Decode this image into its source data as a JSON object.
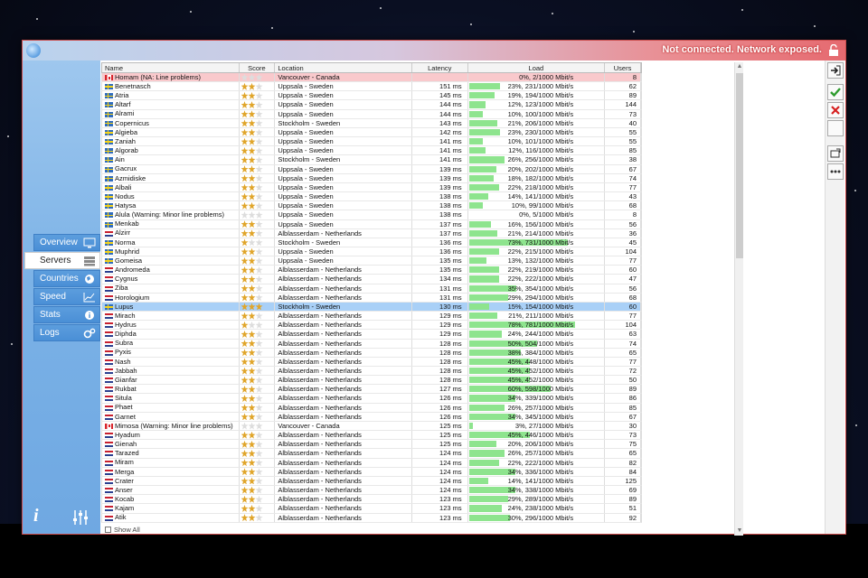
{
  "titlebar": {
    "status": "Not connected. Network exposed."
  },
  "nav": [
    {
      "label": "Overview",
      "icon": "monitor-icon"
    },
    {
      "label": "Servers",
      "icon": "server-icon"
    },
    {
      "label": "Countries",
      "icon": "globe-icon"
    },
    {
      "label": "Speed",
      "icon": "chart-icon"
    },
    {
      "label": "Stats",
      "icon": "info-circle-icon"
    },
    {
      "label": "Logs",
      "icon": "gears-icon"
    }
  ],
  "table": {
    "columns": [
      "Name",
      "Score",
      "Location",
      "Latency",
      "Load",
      "Users"
    ],
    "rows": [
      {
        "name": "Homam (NA: Line problems)",
        "flag": "ca",
        "score": 0,
        "location": "Vancouver - Canada",
        "latency": "",
        "load": "0%, 2/1000 Mbit/s",
        "pct": 0,
        "users": "8",
        "state": "warn"
      },
      {
        "name": "Benetnasch",
        "flag": "se",
        "score": 2,
        "location": "Uppsala - Sweden",
        "latency": "151 ms",
        "load": "23%, 231/1000 Mbit/s",
        "pct": 23,
        "users": "62"
      },
      {
        "name": "Atria",
        "flag": "se",
        "score": 2,
        "location": "Uppsala - Sweden",
        "latency": "145 ms",
        "load": "19%, 194/1000 Mbit/s",
        "pct": 19,
        "users": "89"
      },
      {
        "name": "Altarf",
        "flag": "se",
        "score": 2,
        "location": "Uppsala - Sweden",
        "latency": "144 ms",
        "load": "12%, 123/1000 Mbit/s",
        "pct": 12,
        "users": "144"
      },
      {
        "name": "Alrami",
        "flag": "se",
        "score": 2,
        "location": "Uppsala - Sweden",
        "latency": "144 ms",
        "load": "10%, 100/1000 Mbit/s",
        "pct": 10,
        "users": "73"
      },
      {
        "name": "Copernicus",
        "flag": "se",
        "score": 2,
        "location": "Stockholm - Sweden",
        "latency": "143 ms",
        "load": "21%, 206/1000 Mbit/s",
        "pct": 21,
        "users": "40"
      },
      {
        "name": "Algieba",
        "flag": "se",
        "score": 2,
        "location": "Uppsala - Sweden",
        "latency": "142 ms",
        "load": "23%, 230/1000 Mbit/s",
        "pct": 23,
        "users": "55"
      },
      {
        "name": "Zaniah",
        "flag": "se",
        "score": 2,
        "location": "Uppsala - Sweden",
        "latency": "141 ms",
        "load": "10%, 101/1000 Mbit/s",
        "pct": 10,
        "users": "55"
      },
      {
        "name": "Algorab",
        "flag": "se",
        "score": 2,
        "location": "Uppsala - Sweden",
        "latency": "141 ms",
        "load": "12%, 116/1000 Mbit/s",
        "pct": 12,
        "users": "85"
      },
      {
        "name": "Ain",
        "flag": "se",
        "score": 2,
        "location": "Stockholm - Sweden",
        "latency": "141 ms",
        "load": "26%, 256/1000 Mbit/s",
        "pct": 26,
        "users": "38"
      },
      {
        "name": "Gacrux",
        "flag": "se",
        "score": 2,
        "location": "Uppsala - Sweden",
        "latency": "139 ms",
        "load": "20%, 202/1000 Mbit/s",
        "pct": 20,
        "users": "67"
      },
      {
        "name": "Azmidiske",
        "flag": "se",
        "score": 2,
        "location": "Uppsala - Sweden",
        "latency": "139 ms",
        "load": "18%, 182/1000 Mbit/s",
        "pct": 18,
        "users": "74"
      },
      {
        "name": "Albali",
        "flag": "se",
        "score": 2,
        "location": "Uppsala - Sweden",
        "latency": "139 ms",
        "load": "22%, 218/1000 Mbit/s",
        "pct": 22,
        "users": "77"
      },
      {
        "name": "Nodus",
        "flag": "se",
        "score": 2,
        "location": "Uppsala - Sweden",
        "latency": "138 ms",
        "load": "14%, 141/1000 Mbit/s",
        "pct": 14,
        "users": "43"
      },
      {
        "name": "Hatysa",
        "flag": "se",
        "score": 2,
        "location": "Uppsala - Sweden",
        "latency": "138 ms",
        "load": "10%, 99/1000 Mbit/s",
        "pct": 10,
        "users": "68"
      },
      {
        "name": "Alula (Warning: Minor line problems)",
        "flag": "se",
        "score": 0,
        "location": "Uppsala - Sweden",
        "latency": "138 ms",
        "load": "0%, 5/1000 Mbit/s",
        "pct": 0,
        "users": "8"
      },
      {
        "name": "Menkab",
        "flag": "se",
        "score": 2,
        "location": "Uppsala - Sweden",
        "latency": "137 ms",
        "load": "16%, 156/1000 Mbit/s",
        "pct": 16,
        "users": "56"
      },
      {
        "name": "Alzirr",
        "flag": "nl",
        "score": 2,
        "location": "Alblasserdam - Netherlands",
        "latency": "137 ms",
        "load": "21%, 214/1000 Mbit/s",
        "pct": 21,
        "users": "36"
      },
      {
        "name": "Norma",
        "flag": "se",
        "score": 1,
        "location": "Stockholm - Sweden",
        "latency": "136 ms",
        "load": "73%, 731/1000 Mbit/s",
        "pct": 73,
        "users": "45"
      },
      {
        "name": "Muphrid",
        "flag": "se",
        "score": 2,
        "location": "Uppsala - Sweden",
        "latency": "136 ms",
        "load": "22%, 215/1000 Mbit/s",
        "pct": 22,
        "users": "104"
      },
      {
        "name": "Gomeisa",
        "flag": "se",
        "score": 2,
        "location": "Uppsala - Sweden",
        "latency": "135 ms",
        "load": "13%, 132/1000 Mbit/s",
        "pct": 13,
        "users": "77"
      },
      {
        "name": "Andromeda",
        "flag": "nl",
        "score": 2,
        "location": "Alblasserdam - Netherlands",
        "latency": "135 ms",
        "load": "22%, 219/1000 Mbit/s",
        "pct": 22,
        "users": "60"
      },
      {
        "name": "Cygnus",
        "flag": "nl",
        "score": 2,
        "location": "Alblasserdam - Netherlands",
        "latency": "134 ms",
        "load": "22%, 222/1000 Mbit/s",
        "pct": 22,
        "users": "47"
      },
      {
        "name": "Ziba",
        "flag": "nl",
        "score": 2,
        "location": "Alblasserdam - Netherlands",
        "latency": "131 ms",
        "load": "35%, 354/1000 Mbit/s",
        "pct": 35,
        "users": "56"
      },
      {
        "name": "Horologium",
        "flag": "nl",
        "score": 2,
        "location": "Alblasserdam - Netherlands",
        "latency": "131 ms",
        "load": "29%, 294/1000 Mbit/s",
        "pct": 29,
        "users": "68"
      },
      {
        "name": "Lupus",
        "flag": "se",
        "score": 3,
        "location": "Stockholm - Sweden",
        "latency": "130 ms",
        "load": "15%, 154/1000 Mbit/s",
        "pct": 15,
        "users": "60",
        "state": "selected"
      },
      {
        "name": "Mirach",
        "flag": "nl",
        "score": 2,
        "location": "Alblasserdam - Netherlands",
        "latency": "129 ms",
        "load": "21%, 211/1000 Mbit/s",
        "pct": 21,
        "users": "77"
      },
      {
        "name": "Hydrus",
        "flag": "nl",
        "score": 1,
        "location": "Alblasserdam - Netherlands",
        "latency": "129 ms",
        "load": "78%, 781/1000 Mbit/s",
        "pct": 78,
        "users": "104"
      },
      {
        "name": "Diphda",
        "flag": "nl",
        "score": 2,
        "location": "Alblasserdam - Netherlands",
        "latency": "129 ms",
        "load": "24%, 244/1000 Mbit/s",
        "pct": 24,
        "users": "63"
      },
      {
        "name": "Subra",
        "flag": "nl",
        "score": 2,
        "location": "Alblasserdam - Netherlands",
        "latency": "128 ms",
        "load": "50%, 504/1000 Mbit/s",
        "pct": 50,
        "users": "74"
      },
      {
        "name": "Pyxis",
        "flag": "nl",
        "score": 2,
        "location": "Alblasserdam - Netherlands",
        "latency": "128 ms",
        "load": "38%, 384/1000 Mbit/s",
        "pct": 38,
        "users": "65"
      },
      {
        "name": "Nash",
        "flag": "nl",
        "score": 2,
        "location": "Alblasserdam - Netherlands",
        "latency": "128 ms",
        "load": "45%, 448/1000 Mbit/s",
        "pct": 45,
        "users": "77"
      },
      {
        "name": "Jabbah",
        "flag": "nl",
        "score": 2,
        "location": "Alblasserdam - Netherlands",
        "latency": "128 ms",
        "load": "45%, 452/1000 Mbit/s",
        "pct": 45,
        "users": "72"
      },
      {
        "name": "Gianfar",
        "flag": "nl",
        "score": 2,
        "location": "Alblasserdam - Netherlands",
        "latency": "128 ms",
        "load": "45%, 452/1000 Mbit/s",
        "pct": 45,
        "users": "50"
      },
      {
        "name": "Rukbat",
        "flag": "nl",
        "score": 2,
        "location": "Alblasserdam - Netherlands",
        "latency": "127 ms",
        "load": "60%, 598/1000 Mbit/s",
        "pct": 60,
        "users": "89"
      },
      {
        "name": "Situla",
        "flag": "nl",
        "score": 2,
        "location": "Alblasserdam - Netherlands",
        "latency": "126 ms",
        "load": "34%, 339/1000 Mbit/s",
        "pct": 34,
        "users": "86"
      },
      {
        "name": "Phaet",
        "flag": "nl",
        "score": 2,
        "location": "Alblasserdam - Netherlands",
        "latency": "126 ms",
        "load": "26%, 257/1000 Mbit/s",
        "pct": 26,
        "users": "85"
      },
      {
        "name": "Garnet",
        "flag": "nl",
        "score": 2,
        "location": "Alblasserdam - Netherlands",
        "latency": "126 ms",
        "load": "34%, 345/1000 Mbit/s",
        "pct": 34,
        "users": "67"
      },
      {
        "name": "Mimosa (Warning: Minor line problems)",
        "flag": "ca",
        "score": 0,
        "location": "Vancouver - Canada",
        "latency": "125 ms",
        "load": "3%, 27/1000 Mbit/s",
        "pct": 3,
        "users": "30"
      },
      {
        "name": "Hyadum",
        "flag": "nl",
        "score": 2,
        "location": "Alblasserdam - Netherlands",
        "latency": "125 ms",
        "load": "45%, 446/1000 Mbit/s",
        "pct": 45,
        "users": "73"
      },
      {
        "name": "Gienah",
        "flag": "nl",
        "score": 2,
        "location": "Alblasserdam - Netherlands",
        "latency": "125 ms",
        "load": "20%, 206/1000 Mbit/s",
        "pct": 20,
        "users": "75"
      },
      {
        "name": "Tarazed",
        "flag": "nl",
        "score": 2,
        "location": "Alblasserdam - Netherlands",
        "latency": "124 ms",
        "load": "26%, 257/1000 Mbit/s",
        "pct": 26,
        "users": "65"
      },
      {
        "name": "Miram",
        "flag": "nl",
        "score": 2,
        "location": "Alblasserdam - Netherlands",
        "latency": "124 ms",
        "load": "22%, 222/1000 Mbit/s",
        "pct": 22,
        "users": "82"
      },
      {
        "name": "Merga",
        "flag": "nl",
        "score": 2,
        "location": "Alblasserdam - Netherlands",
        "latency": "124 ms",
        "load": "34%, 336/1000 Mbit/s",
        "pct": 34,
        "users": "84"
      },
      {
        "name": "Crater",
        "flag": "nl",
        "score": 2,
        "location": "Alblasserdam - Netherlands",
        "latency": "124 ms",
        "load": "14%, 141/1000 Mbit/s",
        "pct": 14,
        "users": "125"
      },
      {
        "name": "Anser",
        "flag": "nl",
        "score": 2,
        "location": "Alblasserdam - Netherlands",
        "latency": "124 ms",
        "load": "34%, 338/1000 Mbit/s",
        "pct": 34,
        "users": "69"
      },
      {
        "name": "Kocab",
        "flag": "nl",
        "score": 2,
        "location": "Alblasserdam - Netherlands",
        "latency": "123 ms",
        "load": "29%, 289/1000 Mbit/s",
        "pct": 29,
        "users": "89"
      },
      {
        "name": "Kajam",
        "flag": "nl",
        "score": 2,
        "location": "Alblasserdam - Netherlands",
        "latency": "123 ms",
        "load": "24%, 238/1000 Mbit/s",
        "pct": 24,
        "users": "51"
      },
      {
        "name": "Atik",
        "flag": "nl",
        "score": 2,
        "location": "Alblasserdam - Netherlands",
        "latency": "123 ms",
        "load": "30%, 296/1000 Mbit/s",
        "pct": 30,
        "users": "92"
      }
    ]
  },
  "footer": {
    "show_all_label": "Show All"
  },
  "colors": {
    "load_bar": "#8ee48e",
    "selected_row": "#a9d0f7",
    "warn_row": "#f9c9cc"
  }
}
